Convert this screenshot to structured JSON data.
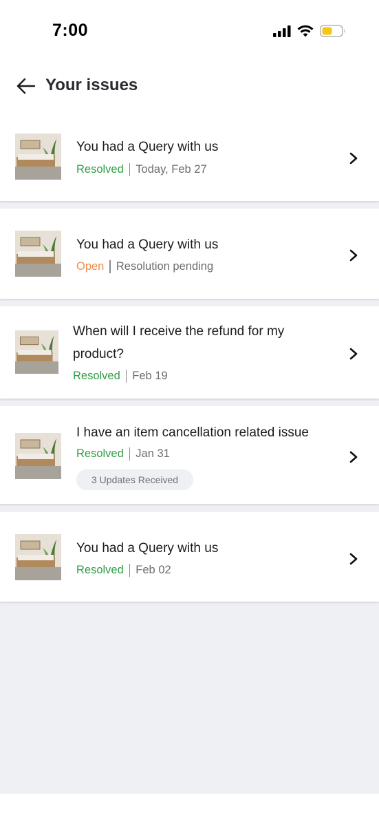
{
  "status_bar": {
    "time": "7:00",
    "icons": [
      "signal-icon",
      "wifi-icon",
      "battery-icon"
    ],
    "battery_color": "#f5c518"
  },
  "header": {
    "back_icon": "arrow-left-icon",
    "title": "Your issues"
  },
  "colors": {
    "resolved": "#2e9e45",
    "open": "#f08a4b",
    "background": "#eff0f3"
  },
  "issues": [
    {
      "title": "You had a Query with us",
      "status": "Resolved",
      "date": "Today, Feb 27"
    },
    {
      "title": "You had a Query with us",
      "status": "Open",
      "date": "Resolution pending"
    },
    {
      "title": "When will I receive the refund for my product?",
      "status": "Resolved",
      "date": "Feb 19"
    },
    {
      "title": "I have an item cancellation related issue",
      "status": "Resolved",
      "date": "Jan 31",
      "badge": "3 Updates Received"
    },
    {
      "title": "You had a Query with us",
      "status": "Resolved",
      "date": "Feb 02"
    }
  ]
}
